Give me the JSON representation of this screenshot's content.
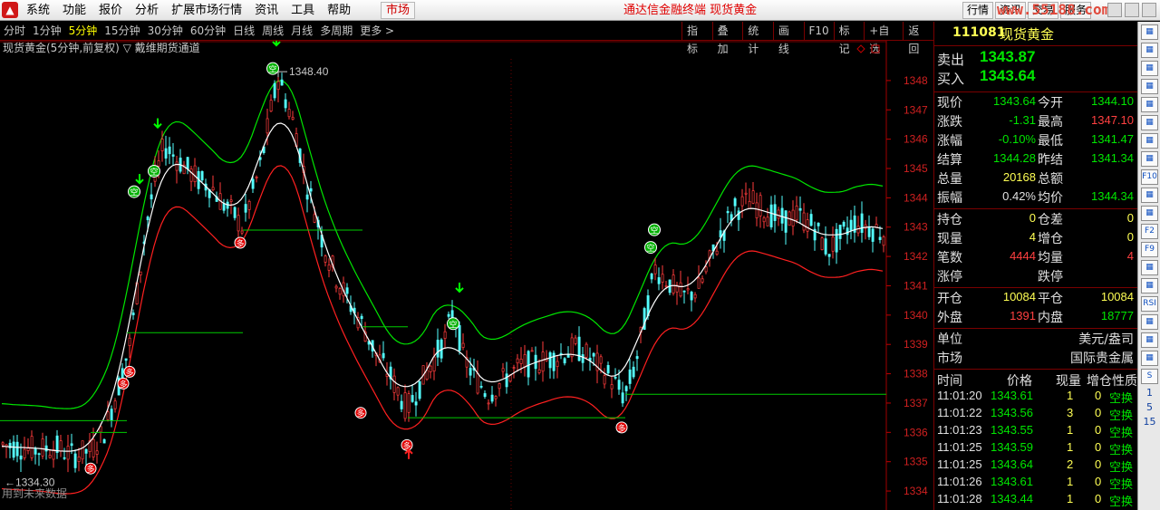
{
  "menubar": {
    "items": [
      "系统",
      "功能",
      "报价",
      "分析",
      "扩展市场行情",
      "资讯",
      "工具",
      "帮助"
    ],
    "market": "市场",
    "headline": "通达信金融终端  现货黄金",
    "right_tabs": [
      "行情",
      "资讯",
      "交易",
      "服务"
    ],
    "watermark": "www.55188.com"
  },
  "periods": [
    "分时",
    "1分钟",
    "5分钟",
    "15分钟",
    "30分钟",
    "60分钟",
    "日线",
    "周线",
    "月线",
    "多周期",
    "更多 >"
  ],
  "active_period": "5分钟",
  "tools": [
    "指标",
    "叠加",
    "统计",
    "画线",
    "F10",
    "标记",
    "+自选",
    "返回"
  ],
  "chart": {
    "title": "现货黄金(5分钟,前复权) ▽ 戴维期货通道",
    "footnote": "用到未来数据",
    "high_label": "1348.40",
    "low_label": "←1334.30",
    "buy_label": "多",
    "sell_label": "空"
  },
  "chart_data": {
    "type": "candlestick",
    "title": "现货黄金(5分钟,前复权) ▽ 戴维期货通道",
    "ylim": [
      1333.6,
      1348.8
    ],
    "y_ticks": [
      1334,
      1335,
      1336,
      1337,
      1338,
      1339,
      1340,
      1341,
      1342,
      1343,
      1344,
      1345,
      1346,
      1347,
      1348
    ],
    "price_path": [
      [
        0,
        1335.6
      ],
      [
        20,
        1335.5
      ],
      [
        40,
        1335.4
      ],
      [
        60,
        1335.5
      ],
      [
        80,
        1335.2
      ],
      [
        100,
        1335.4
      ],
      [
        115,
        1336.1
      ],
      [
        130,
        1337.6
      ],
      [
        142,
        1339.0
      ],
      [
        152,
        1341.2
      ],
      [
        160,
        1343.0
      ],
      [
        170,
        1344.6
      ],
      [
        180,
        1345.8
      ],
      [
        192,
        1345.4
      ],
      [
        205,
        1345.0
      ],
      [
        218,
        1344.6
      ],
      [
        232,
        1344.4
      ],
      [
        245,
        1343.8
      ],
      [
        258,
        1343.4
      ],
      [
        266,
        1343.0
      ],
      [
        276,
        1344.0
      ],
      [
        288,
        1345.3
      ],
      [
        298,
        1347.0
      ],
      [
        306,
        1348.1
      ],
      [
        316,
        1347.2
      ],
      [
        326,
        1346.2
      ],
      [
        336,
        1344.6
      ],
      [
        346,
        1343.6
      ],
      [
        356,
        1342.4
      ],
      [
        370,
        1341.3
      ],
      [
        385,
        1340.4
      ],
      [
        400,
        1339.6
      ],
      [
        415,
        1338.6
      ],
      [
        430,
        1337.9
      ],
      [
        448,
        1336.8
      ],
      [
        462,
        1337.6
      ],
      [
        476,
        1338.4
      ],
      [
        490,
        1339.2
      ],
      [
        500,
        1340.2
      ],
      [
        510,
        1338.6
      ],
      [
        522,
        1337.9
      ],
      [
        538,
        1337.3
      ],
      [
        555,
        1337.8
      ],
      [
        575,
        1338.3
      ],
      [
        595,
        1338.4
      ],
      [
        615,
        1338.6
      ],
      [
        635,
        1338.9
      ],
      [
        655,
        1338.4
      ],
      [
        672,
        1337.9
      ],
      [
        688,
        1337.2
      ],
      [
        700,
        1338.3
      ],
      [
        712,
        1340.1
      ],
      [
        722,
        1341.6
      ],
      [
        735,
        1341.2
      ],
      [
        752,
        1340.6
      ],
      [
        770,
        1340.9
      ],
      [
        790,
        1342.4
      ],
      [
        808,
        1343.6
      ],
      [
        828,
        1343.9
      ],
      [
        845,
        1343.5
      ],
      [
        862,
        1343.2
      ],
      [
        880,
        1343.4
      ],
      [
        898,
        1343.0
      ],
      [
        912,
        1342.2
      ],
      [
        925,
        1342.6
      ],
      [
        940,
        1343.2
      ],
      [
        958,
        1343.0
      ],
      [
        975,
        1342.8
      ]
    ],
    "signals": {
      "buy": [
        {
          "x": 100,
          "price": 1335.2
        },
        {
          "x": 136,
          "price": 1338.1
        },
        {
          "x": 143,
          "price": 1338.5
        },
        {
          "x": 265,
          "price": 1342.9
        },
        {
          "x": 398,
          "price": 1337.1
        },
        {
          "x": 449,
          "price": 1336.0
        },
        {
          "x": 686,
          "price": 1336.6
        }
      ],
      "sell": [
        {
          "x": 148,
          "price": 1343.9
        },
        {
          "x": 170,
          "price": 1344.6
        },
        {
          "x": 301,
          "price": 1348.1
        },
        {
          "x": 500,
          "price": 1339.4
        },
        {
          "x": 718,
          "price": 1342.0
        },
        {
          "x": 722,
          "price": 1342.6
        }
      ],
      "green_arrows_down": [
        {
          "x": 154,
          "price": 1344.5
        },
        {
          "x": 174,
          "price": 1346.4
        },
        {
          "x": 305,
          "price": 1349.2
        },
        {
          "x": 507,
          "price": 1340.8
        }
      ],
      "red_arrows_up": [
        {
          "x": 451,
          "price": 1335.4
        }
      ]
    },
    "support_lines": [
      {
        "x0": 0,
        "x1": 140,
        "price": 1336.4
      },
      {
        "x0": 100,
        "x1": 140,
        "price": 1336.0
      },
      {
        "x0": 140,
        "x1": 268,
        "price": 1339.4
      },
      {
        "x0": 268,
        "x1": 400,
        "price": 1342.9
      },
      {
        "x0": 400,
        "x1": 450,
        "price": 1339.6
      },
      {
        "x0": 450,
        "x1": 690,
        "price": 1336.5
      },
      {
        "x0": 690,
        "x1": 978,
        "price": 1337.3
      }
    ],
    "colors": {
      "up": "#ff3c3c",
      "down": "#54ffff",
      "mid": "#ffffff",
      "upper": "#00e600",
      "lower": "#ff2020",
      "support": "#00cc00"
    }
  },
  "quote": {
    "code": "111081",
    "name": "现货黄金",
    "sell_label": "卖出",
    "sell_value": "1343.87",
    "buy_label": "买入",
    "buy_value": "1343.64",
    "rows": [
      {
        "l1": "现价",
        "v1": "1343.64",
        "c1": "green",
        "l2": "今开",
        "v2": "1344.10",
        "c2": "green"
      },
      {
        "l1": "涨跌",
        "v1": "-1.31",
        "c1": "green",
        "l2": "最高",
        "v2": "1347.10",
        "c2": "red"
      },
      {
        "l1": "涨幅",
        "v1": "-0.10%",
        "c1": "green",
        "l2": "最低",
        "v2": "1341.47",
        "c2": "green"
      },
      {
        "l1": "结算",
        "v1": "1344.28",
        "c1": "green",
        "l2": "昨结",
        "v2": "1341.34",
        "c2": "green"
      },
      {
        "l1": "总量",
        "v1": "20168",
        "c1": "yellow",
        "l2": "总额",
        "v2": "",
        "c2": "white"
      },
      {
        "l1": "振幅",
        "v1": "0.42%",
        "c1": "white",
        "l2": "均价",
        "v2": "1344.34",
        "c2": "green"
      }
    ],
    "rows2": [
      {
        "l1": "持仓",
        "v1": "0",
        "c1": "yellow",
        "l2": "仓差",
        "v2": "0",
        "c2": "yellow"
      },
      {
        "l1": "现量",
        "v1": "4",
        "c1": "yellow",
        "l2": "增仓",
        "v2": "0",
        "c2": "yellow"
      },
      {
        "l1": "笔数",
        "v1": "4444",
        "c1": "red",
        "l2": "均量",
        "v2": "4",
        "c2": "red"
      },
      {
        "l1": "涨停",
        "v1": "",
        "c1": "white",
        "l2": "跌停",
        "v2": "",
        "c2": "white"
      }
    ],
    "rows3": [
      {
        "l1": "开仓",
        "v1": "10084",
        "c1": "yellow",
        "l2": "平仓",
        "v2": "10084",
        "c2": "yellow"
      },
      {
        "l1": "外盘",
        "v1": "1391",
        "c1": "red",
        "l2": "内盘",
        "v2": "18777",
        "c2": "green"
      }
    ],
    "unit_label": "单位",
    "unit_value": "美元/盎司",
    "market_label": "市场",
    "market_value": "国际贵金属",
    "ticks_header": [
      "时间",
      "价格",
      "现量",
      "增仓",
      "性质"
    ],
    "ticks": [
      {
        "time": "11:01:20",
        "price": "1343.61",
        "vol": "1",
        "oi": "0",
        "type": "空换"
      },
      {
        "time": "11:01:22",
        "price": "1343.56",
        "vol": "3",
        "oi": "0",
        "type": "空换"
      },
      {
        "time": "11:01:23",
        "price": "1343.55",
        "vol": "1",
        "oi": "0",
        "type": "空换"
      },
      {
        "time": "11:01:25",
        "price": "1343.59",
        "vol": "1",
        "oi": "0",
        "type": "空换"
      },
      {
        "time": "11:01:25",
        "price": "1343.64",
        "vol": "2",
        "oi": "0",
        "type": "空换"
      },
      {
        "time": "11:01:26",
        "price": "1343.61",
        "vol": "1",
        "oi": "0",
        "type": "空换"
      },
      {
        "time": "11:01:28",
        "price": "1343.44",
        "vol": "1",
        "oi": "0",
        "type": "空换"
      }
    ]
  },
  "iconstrip": {
    "icons": [
      "up-icon",
      "list-icon",
      "news-icon",
      "grid-icon",
      "table-icon",
      "line-chart-icon",
      "candle-icon",
      "doc-icon",
      "f10-icon",
      "book-icon",
      "grid2-icon",
      "f2-icon",
      "f9-icon",
      "bars-icon",
      "macd-icon",
      "rsi-icon",
      "drop-icon",
      "move-icon",
      "pen-icon",
      "s-icon"
    ],
    "labels": [
      "",
      "",
      "",
      "",
      "",
      "",
      "",
      "",
      "F10",
      "",
      "",
      "F2",
      "F9",
      "",
      "",
      "RSI",
      "",
      "",
      "",
      "S"
    ],
    "numbers": [
      "1",
      "5",
      "15"
    ]
  }
}
